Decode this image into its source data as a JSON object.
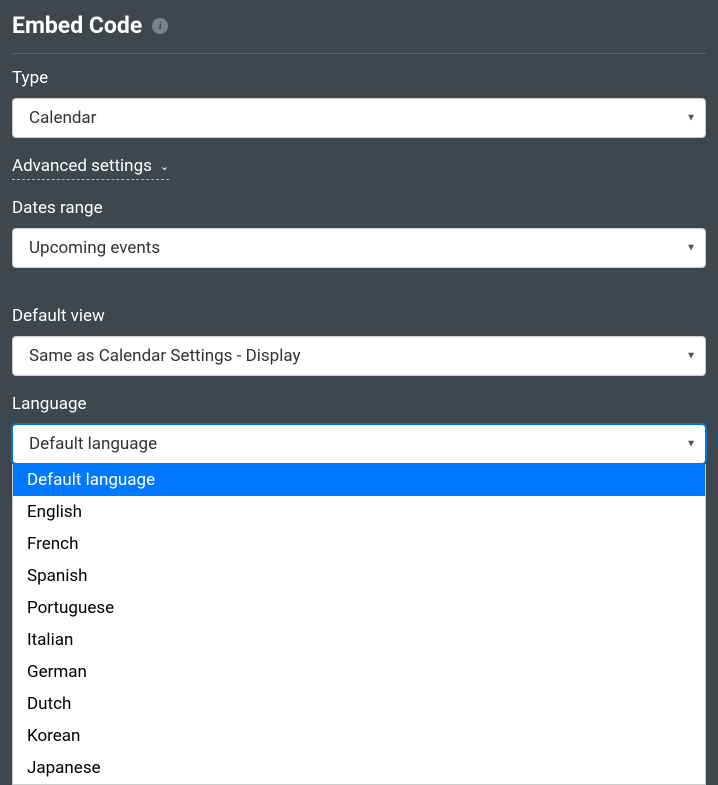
{
  "header": {
    "title": "Embed Code"
  },
  "type_field": {
    "label": "Type",
    "value": "Calendar"
  },
  "advanced_settings": {
    "label": "Advanced settings"
  },
  "dates_range": {
    "label": "Dates range",
    "value": "Upcoming events"
  },
  "default_view": {
    "label": "Default view",
    "value": "Same as Calendar Settings - Display"
  },
  "language": {
    "label": "Language",
    "value": "Default language",
    "options": [
      "Default language",
      "English",
      "French",
      "Spanish",
      "Portuguese",
      "Italian",
      "German",
      "Dutch",
      "Korean",
      "Japanese"
    ]
  }
}
